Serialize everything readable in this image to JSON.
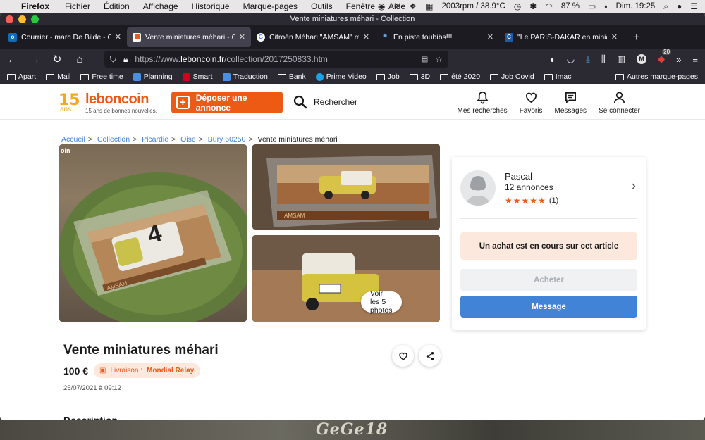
{
  "menubar": {
    "app": "Firefox",
    "items": [
      "Fichier",
      "Édition",
      "Affichage",
      "Historique",
      "Marque-pages",
      "Outils",
      "Fenêtre",
      "Aide"
    ],
    "status": "2003rpm / 38.9°C",
    "battery": "87 %",
    "clock": "Dim. 19:25"
  },
  "window": {
    "title": "Vente miniatures méhari - Collection"
  },
  "tabs": [
    {
      "label": "Courrier - marc De Bilde - Outlo",
      "favicon": "outlook-icon",
      "color": "#0f6cbd"
    },
    {
      "label": "Vente miniatures méhari - Colle",
      "favicon": "leboncoin-icon",
      "color": "#ec5a13",
      "active": true
    },
    {
      "label": "Citroën Méhari \"AMSAM\" miniat",
      "favicon": "google-icon",
      "color": "#ffffff"
    },
    {
      "label": "En piste toubibs!!!",
      "favicon": "chat-icon",
      "color": "#4a90e2"
    },
    {
      "label": "\"Le PARIS-DAKAR en miniature",
      "favicon": "c-icon",
      "color": "#1f5aa6"
    }
  ],
  "urlbar": {
    "prefix": "https://www.",
    "domain": "leboncoin.fr",
    "path": "/collection/2017250833.htm"
  },
  "toolbar_badge": "20",
  "bookmarks": [
    {
      "label": "Apart",
      "type": "folder"
    },
    {
      "label": "Mail",
      "type": "folder"
    },
    {
      "label": "Free time",
      "type": "folder"
    },
    {
      "label": "Planning",
      "type": "site",
      "color": "#4a90e2"
    },
    {
      "label": "Smart",
      "type": "site",
      "color": "#d0021b"
    },
    {
      "label": "Traduction",
      "type": "site",
      "color": "#4a90e2"
    },
    {
      "label": "Bank",
      "type": "folder"
    },
    {
      "label": "Prime Video",
      "type": "site",
      "color": "#1aa3e8"
    },
    {
      "label": "Job",
      "type": "folder"
    },
    {
      "label": "3D",
      "type": "folder"
    },
    {
      "label": "été 2020",
      "type": "folder"
    },
    {
      "label": "Job Covid",
      "type": "folder"
    },
    {
      "label": "Imac",
      "type": "folder"
    }
  ],
  "bookmarks_other": "Autres marque-pages",
  "site": {
    "logo_years": "15",
    "logo_ans": "ans",
    "logo_name": "leboncoin",
    "logo_tagline": "15 ans de bonnes nouvelles.",
    "deposit_label": "Déposer une annonce",
    "search_label": "Rechercher",
    "nav": [
      "Mes recherches",
      "Favoris",
      "Messages",
      "Se connecter"
    ]
  },
  "breadcrumb": [
    "Accueil",
    "Collection",
    "Picardie",
    "Oise",
    "Bury 60250"
  ],
  "breadcrumb_current": "Vente miniatures méhari",
  "photos": {
    "corner_label": "oin",
    "more_label": "Voir les 5 photos",
    "box_text": "AMSAM",
    "car_number": "4"
  },
  "listing": {
    "title": "Vente miniatures méhari",
    "price": "100 €",
    "shipping_prefix": "Livraison :",
    "shipping_carrier": "Mondial Relay",
    "date": "25/07/2021 à 09:12",
    "next_section": "Description"
  },
  "seller": {
    "name": "Pascal",
    "listings": "12 annonces",
    "rating": 5,
    "rating_count": "(1)",
    "notice": "Un achat est en cours sur cet article",
    "buy_label": "Acheter",
    "message_label": "Message"
  },
  "colors": {
    "brand_orange": "#ec5a13",
    "link_blue": "#4183d7",
    "firefox_dark": "#2b2a33"
  },
  "wallpaper_text": "GeGe18"
}
